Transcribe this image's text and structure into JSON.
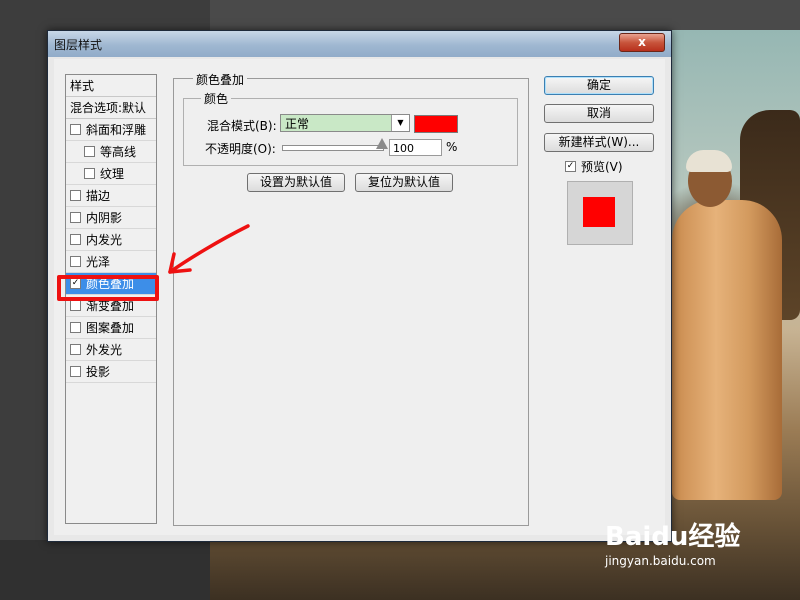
{
  "dialog": {
    "title": "图层样式",
    "close_glyph": "x"
  },
  "style_list": {
    "header": "样式",
    "blend_options": "混合选项:默认",
    "items": [
      {
        "label": "斜面和浮雕",
        "checked": false,
        "sub": false
      },
      {
        "label": "等高线",
        "checked": false,
        "sub": true
      },
      {
        "label": "纹理",
        "checked": false,
        "sub": true
      },
      {
        "label": "描边",
        "checked": false,
        "sub": false
      },
      {
        "label": "内阴影",
        "checked": false,
        "sub": false
      },
      {
        "label": "内发光",
        "checked": false,
        "sub": false
      },
      {
        "label": "光泽",
        "checked": false,
        "sub": false
      },
      {
        "label": "颜色叠加",
        "checked": true,
        "sub": false,
        "selected": true
      },
      {
        "label": "渐变叠加",
        "checked": false,
        "sub": false
      },
      {
        "label": "图案叠加",
        "checked": false,
        "sub": false
      },
      {
        "label": "外发光",
        "checked": false,
        "sub": false
      },
      {
        "label": "投影",
        "checked": false,
        "sub": false
      }
    ]
  },
  "panel": {
    "title": "颜色叠加",
    "group_title": "颜色",
    "blend_mode_label": "混合模式(B):",
    "blend_mode_value": "正常",
    "opacity_label": "不透明度(O):",
    "opacity_value": "100",
    "opacity_unit": "%",
    "opacity_fraction": 1.0,
    "overlay_color": "#ff0000",
    "set_default_btn": "设置为默认值",
    "reset_default_btn": "复位为默认值"
  },
  "actions": {
    "ok": "确定",
    "cancel": "取消",
    "new_style": "新建样式(W)...",
    "preview_label": "预览(V)",
    "preview_checked": true
  },
  "annotation": {
    "highlight_color": "#ee1111"
  },
  "watermark": {
    "logo": "Baidu经验",
    "url": "jingyan.baidu.com"
  }
}
